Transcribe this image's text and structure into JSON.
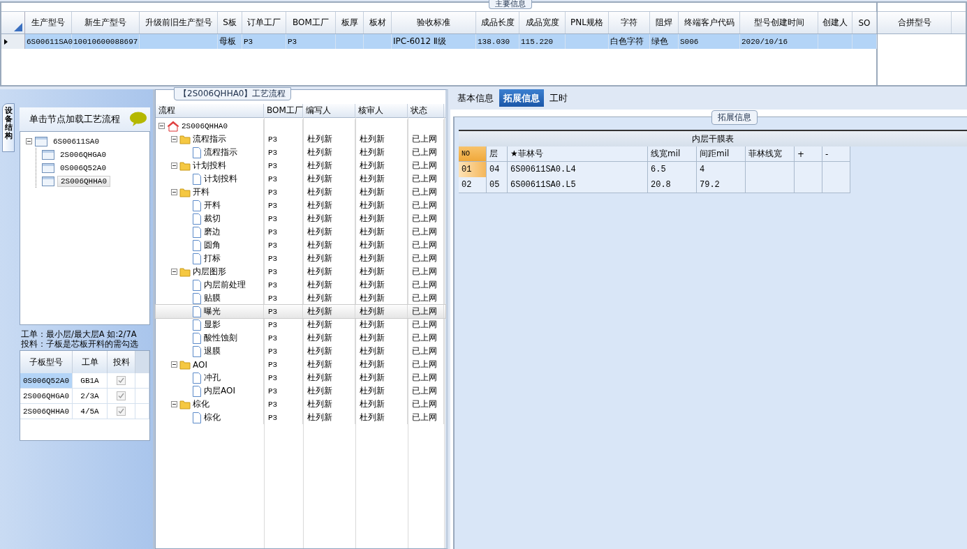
{
  "main_info": {
    "title": "主要信息",
    "columns": [
      "生产型号",
      "新生产型号",
      "升级前旧生产型号",
      "S板",
      "订单工厂",
      "BOM工厂",
      "板厚",
      "板材",
      "验收标准",
      "成品长度",
      "成品宽度",
      "PNL规格",
      "字符",
      "阻焊",
      "终端客户代码",
      "型号创建时间",
      "创建人",
      "SO"
    ],
    "rows": [
      {
        "selected": true,
        "cells": [
          "6S00611SA0",
          "10010600088697",
          "",
          "母板",
          "P3",
          "P3",
          "",
          "",
          "IPC-6012 Ⅱ级",
          "138.030",
          "115.220",
          "",
          "白色字符",
          "绿色",
          "S006",
          "2020/10/16",
          "",
          ""
        ]
      }
    ]
  },
  "merge_panel": {
    "columns": [
      "合拼型号"
    ]
  },
  "structure_panel": {
    "side_tab": "设备结构",
    "hint": "单击节点加载工艺流程",
    "tree": [
      {
        "label": "6S00611SA0",
        "expanded": true,
        "selected": false,
        "children": [
          {
            "label": "2S006QHGA0",
            "selected": false
          },
          {
            "label": "0S006Q52A0",
            "selected": false
          },
          {
            "label": "2S006QHHA0",
            "selected": true
          }
        ]
      }
    ],
    "notes": [
      "工单：最小层/最大层A 如:2/7A",
      "投料：子板是芯板开料的需勾选"
    ],
    "sub_table": {
      "columns": [
        "子板型号",
        "工单",
        "投料"
      ],
      "rows": [
        {
          "model": "0S006Q52A0",
          "order": "GB1A",
          "feed": true,
          "selected": true
        },
        {
          "model": "2S006QHGA0",
          "order": "2/3A",
          "feed": true,
          "selected": false
        },
        {
          "model": "2S006QHHA0",
          "order": "4/5A",
          "feed": true,
          "selected": false
        }
      ]
    }
  },
  "flow_panel": {
    "title": "【2S006QHHA0】工艺流程",
    "columns": [
      "流程",
      "BOM工厂",
      "编写人",
      "核审人",
      "状态"
    ],
    "root": {
      "label": "2S006QHHA0",
      "kind": "home",
      "expanded": true,
      "children": [
        {
          "kind": "folder",
          "label": "流程指示",
          "bom": "P3",
          "writer": "杜列新",
          "reviewer": "杜列新",
          "status": "已上网",
          "expanded": true,
          "selected": false,
          "children": [
            {
              "kind": "step",
              "label": "流程指示",
              "bom": "P3",
              "writer": "杜列新",
              "reviewer": "杜列新",
              "status": "已上网",
              "selected": false
            }
          ]
        },
        {
          "kind": "folder",
          "label": "计划投料",
          "bom": "P3",
          "writer": "杜列新",
          "reviewer": "杜列新",
          "status": "已上网",
          "expanded": true,
          "selected": false,
          "children": [
            {
              "kind": "step",
              "label": "计划投料",
              "bom": "P3",
              "writer": "杜列新",
              "reviewer": "杜列新",
              "status": "已上网",
              "selected": false
            }
          ]
        },
        {
          "kind": "folder",
          "label": "开料",
          "bom": "P3",
          "writer": "杜列新",
          "reviewer": "杜列新",
          "status": "已上网",
          "expanded": true,
          "selected": false,
          "children": [
            {
              "kind": "step",
              "label": "开料",
              "bom": "P3",
              "writer": "杜列新",
              "reviewer": "杜列新",
              "status": "已上网",
              "selected": false
            },
            {
              "kind": "step",
              "label": "裁切",
              "bom": "P3",
              "writer": "杜列新",
              "reviewer": "杜列新",
              "status": "已上网",
              "selected": false
            },
            {
              "kind": "step",
              "label": "磨边",
              "bom": "P3",
              "writer": "杜列新",
              "reviewer": "杜列新",
              "status": "已上网",
              "selected": false
            },
            {
              "kind": "step",
              "label": "圆角",
              "bom": "P3",
              "writer": "杜列新",
              "reviewer": "杜列新",
              "status": "已上网",
              "selected": false
            },
            {
              "kind": "step",
              "label": "打标",
              "bom": "P3",
              "writer": "杜列新",
              "reviewer": "杜列新",
              "status": "已上网",
              "selected": false
            }
          ]
        },
        {
          "kind": "folder",
          "label": "内层图形",
          "bom": "P3",
          "writer": "杜列新",
          "reviewer": "杜列新",
          "status": "已上网",
          "expanded": true,
          "selected": false,
          "children": [
            {
              "kind": "step",
              "label": "内层前处理",
              "bom": "P3",
              "writer": "杜列新",
              "reviewer": "杜列新",
              "status": "已上网",
              "selected": false
            },
            {
              "kind": "step",
              "label": "贴膜",
              "bom": "P3",
              "writer": "杜列新",
              "reviewer": "杜列新",
              "status": "已上网",
              "selected": false
            },
            {
              "kind": "step",
              "label": "曝光",
              "bom": "P3",
              "writer": "杜列新",
              "reviewer": "杜列新",
              "status": "已上网",
              "selected": true
            },
            {
              "kind": "step",
              "label": "显影",
              "bom": "P3",
              "writer": "杜列新",
              "reviewer": "杜列新",
              "status": "已上网",
              "selected": false
            },
            {
              "kind": "step",
              "label": "酸性蚀刻",
              "bom": "P3",
              "writer": "杜列新",
              "reviewer": "杜列新",
              "status": "已上网",
              "selected": false
            },
            {
              "kind": "step",
              "label": "退膜",
              "bom": "P3",
              "writer": "杜列新",
              "reviewer": "杜列新",
              "status": "已上网",
              "selected": false
            }
          ]
        },
        {
          "kind": "folder",
          "label": "AOI",
          "bom": "P3",
          "writer": "杜列新",
          "reviewer": "杜列新",
          "status": "已上网",
          "expanded": true,
          "selected": false,
          "children": [
            {
              "kind": "step",
              "label": "冲孔",
              "bom": "P3",
              "writer": "杜列新",
              "reviewer": "杜列新",
              "status": "已上网",
              "selected": false
            },
            {
              "kind": "step",
              "label": "内层AOI",
              "bom": "P3",
              "writer": "杜列新",
              "reviewer": "杜列新",
              "status": "已上网",
              "selected": false
            }
          ]
        },
        {
          "kind": "folder",
          "label": "棕化",
          "bom": "P3",
          "writer": "杜列新",
          "reviewer": "杜列新",
          "status": "已上网",
          "expanded": true,
          "selected": false,
          "children": [
            {
              "kind": "step",
              "label": "棕化",
              "bom": "P3",
              "writer": "杜列新",
              "reviewer": "杜列新",
              "status": "已上网",
              "selected": false
            }
          ]
        }
      ]
    }
  },
  "detail_panel": {
    "tabs": [
      {
        "label": "基本信息",
        "selected": false
      },
      {
        "label": "拓展信息",
        "selected": true
      },
      {
        "label": "工时",
        "selected": false
      }
    ],
    "group_title": "拓展信息",
    "table": {
      "caption": "内层干膜表",
      "columns": [
        "NO",
        "层",
        "★菲林号",
        "线宽mil",
        "间距mil",
        "菲林线宽",
        "+",
        "-"
      ],
      "rows": [
        {
          "selected": true,
          "cells": [
            "01",
            "04",
            "6S00611SA0.L4",
            "6.5",
            "4",
            "",
            "",
            ""
          ]
        },
        {
          "selected": false,
          "cells": [
            "02",
            "05",
            "6S00611SA0.L5",
            "20.8",
            "79.2",
            "",
            "",
            ""
          ]
        }
      ]
    }
  }
}
